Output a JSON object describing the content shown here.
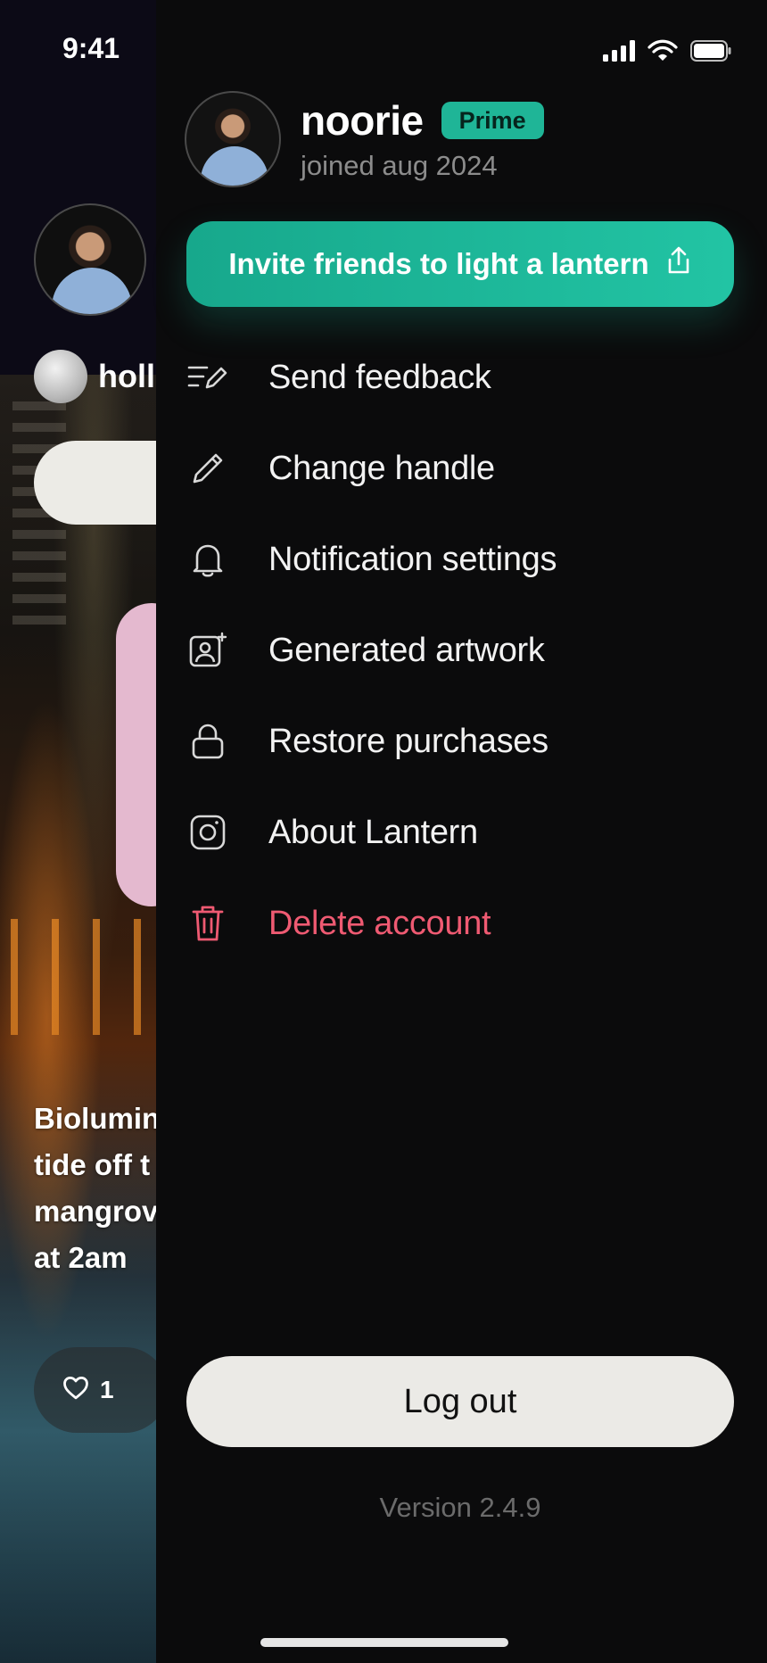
{
  "status_bar": {
    "time": "9:41",
    "icons": [
      "cellular-signal-icon",
      "wifi-icon",
      "battery-icon"
    ]
  },
  "feed": {
    "handle": "holl",
    "caption": [
      "Biolumin",
      "tide off t",
      "mangrov",
      "at 2am"
    ],
    "like_count": "1"
  },
  "profile": {
    "name": "noorie",
    "badge": "Prime",
    "joined": "joined aug 2024"
  },
  "invite": {
    "label": "Invite friends to light a lantern",
    "icon": "share-icon"
  },
  "menu": {
    "items": [
      {
        "label": "Send feedback",
        "icon": "feedback-icon"
      },
      {
        "label": "Change handle",
        "icon": "pencil-icon"
      },
      {
        "label": "Notification settings",
        "icon": "bell-icon"
      },
      {
        "label": "Generated artwork",
        "icon": "artwork-icon"
      },
      {
        "label": "Restore purchases",
        "icon": "lock-icon"
      },
      {
        "label": "About Lantern",
        "icon": "info-app-icon"
      },
      {
        "label": "Delete account",
        "icon": "trash-icon"
      }
    ]
  },
  "logout_label": "Log out",
  "version": "Version 2.4.9",
  "colors": {
    "accent": "#1fb597",
    "danger": "#ef5a72",
    "background": "#0b0b0c",
    "logout_bg": "#ebeae6"
  }
}
